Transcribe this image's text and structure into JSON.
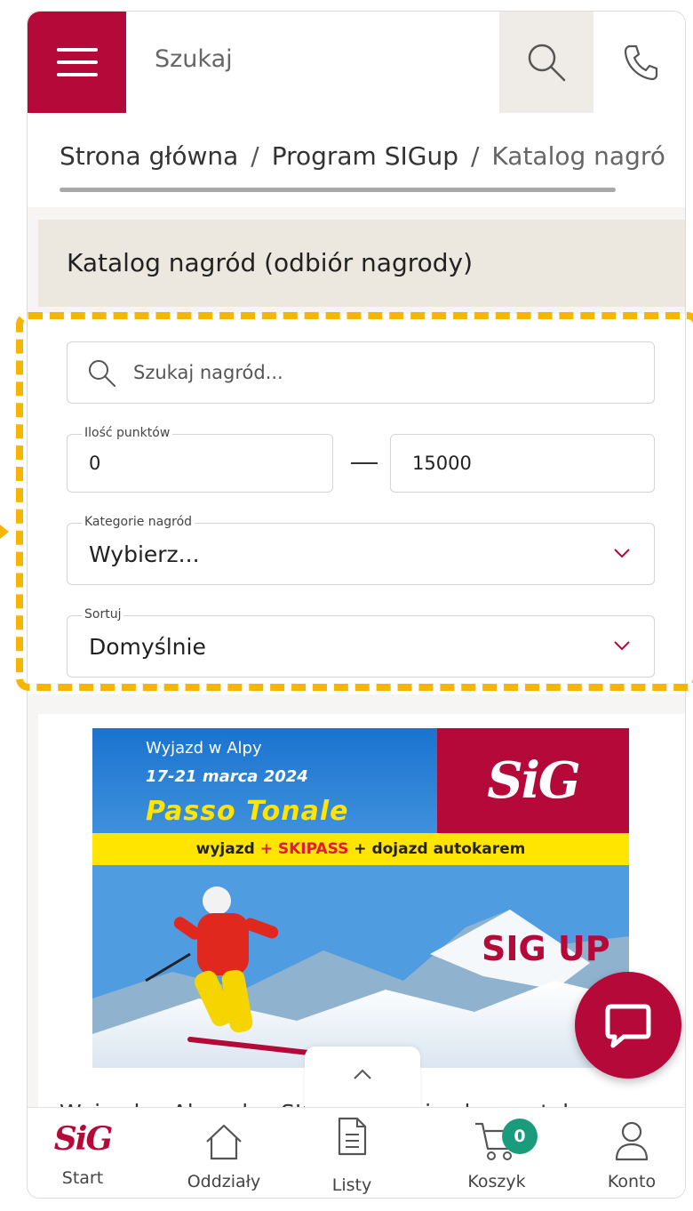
{
  "header": {
    "search_placeholder": "Szukaj",
    "icons": [
      "menu-icon",
      "search-icon",
      "phone-icon"
    ]
  },
  "breadcrumb": {
    "items": [
      "Strona główna",
      "Program SIGup",
      "Katalog nagró"
    ],
    "separator": "/"
  },
  "page": {
    "title": "Katalog nagród (odbiór nagrody)"
  },
  "filters": {
    "search_placeholder": "Szukaj nagród...",
    "points_label": "Ilość punktów",
    "points_min": "0",
    "points_max": "15000",
    "category_label": "Kategorie nagród",
    "category_value": "Wybierz...",
    "sort_label": "Sortuj",
    "sort_value": "Domyślnie"
  },
  "banner": {
    "line1": "Wyjazd w Alpy",
    "line2": "17-21 marca 2024",
    "line3": "Passo Tonale",
    "bar_part1": "wyjazd",
    "bar_part2": "+ SKIPASS",
    "bar_part3": "+ dojazd autokarem",
    "logo": "SiG",
    "sigup_logo": "SIG UP"
  },
  "product": {
    "title": "Wyjazd w Alpy plus SKIPASS z dojazdem autokarem"
  },
  "bottom_nav": {
    "start": "Start",
    "branches": "Oddziały",
    "lists": "Listy",
    "cart": "Koszyk",
    "cart_count": "0",
    "account": "Konto",
    "logo": "SiG"
  },
  "colors": {
    "brand": "#b5093a",
    "highlight": "#f6b500",
    "badge": "#1a9c7c"
  }
}
